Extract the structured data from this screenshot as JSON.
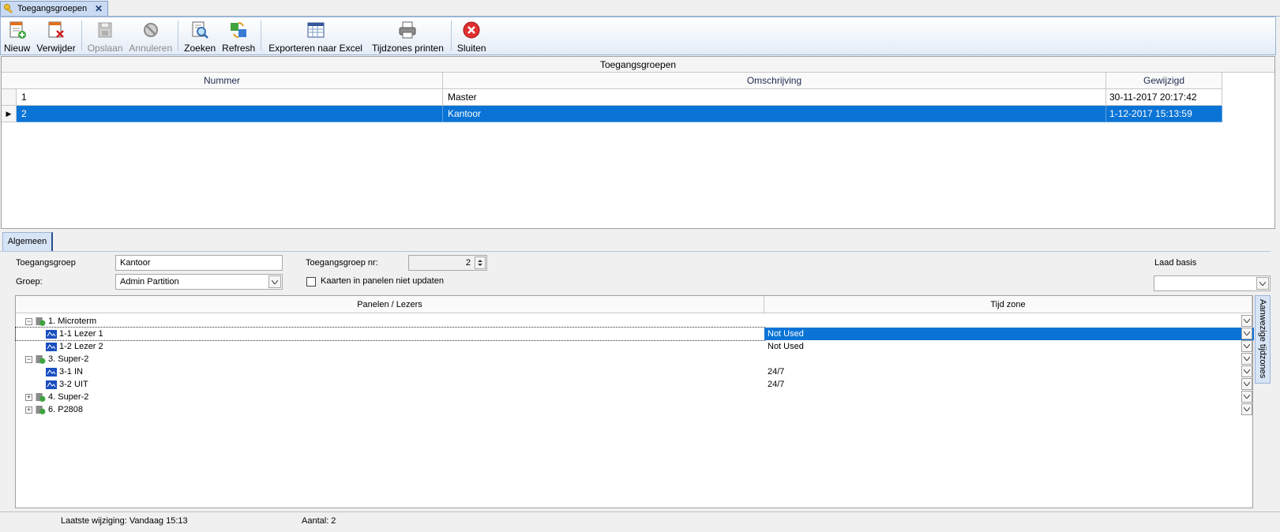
{
  "doc_tab": {
    "title": "Toegangsgroepen",
    "close": "✕"
  },
  "toolbar": {
    "new": "Nieuw",
    "delete": "Verwijder",
    "save": "Opslaan",
    "cancel": "Annuleren",
    "search": "Zoeken",
    "refresh": "Refresh",
    "export": "Exporteren naar Excel",
    "print": "Tijdzones printen",
    "close": "Sluiten"
  },
  "grid": {
    "caption": "Toegangsgroepen",
    "columns": [
      "Nummer",
      "Omschrijving",
      "Gewijzigd"
    ],
    "rows": [
      {
        "nummer": "1",
        "omschrijving": "Master",
        "gewijzigd": "30-11-2017 20:17:42"
      },
      {
        "nummer": "2",
        "omschrijving": "Kantoor",
        "gewijzigd": "1-12-2017 15:13:59"
      }
    ],
    "selected_row_marker": "▶"
  },
  "tab": {
    "algemeen": "Algemeen"
  },
  "form": {
    "toegangsgroep_label": "Toegangsgroep",
    "toegangsgroep_value": "Kantoor",
    "groep_label": "Groep:",
    "groep_value": "Admin Partition",
    "nr_label": "Toegangsgroep nr:",
    "nr_value": "2",
    "checkbox_label": "Kaarten in panelen niet updaten",
    "laad_basis_label": "Laad basis",
    "laad_basis_value": ""
  },
  "tree": {
    "columns": [
      "Panelen / Lezers",
      "Tijd zone"
    ],
    "rows": [
      {
        "name": "1. Microterm",
        "zone": "",
        "expander": "−"
      },
      {
        "name": "1-1 Lezer 1",
        "zone": "Not Used"
      },
      {
        "name": "1-2 Lezer 2",
        "zone": "Not Used"
      },
      {
        "name": "3. Super-2",
        "zone": "",
        "expander": "−"
      },
      {
        "name": "3-1 IN",
        "zone": "24/7"
      },
      {
        "name": "3-2 UIT",
        "zone": "24/7"
      },
      {
        "name": "4. Super-2",
        "zone": "",
        "expander": "+"
      },
      {
        "name": "6. P2808",
        "zone": "",
        "expander": "+"
      }
    ]
  },
  "side_tab": "Aanwezige tijdzones",
  "status": {
    "last_change": "Laatste wijziging: Vandaag 15:13",
    "count": "Aantal: 2"
  },
  "icons": {
    "new": "new-document-icon",
    "delete": "delete-document-icon",
    "save": "save-icon",
    "cancel": "cancel-icon",
    "search": "search-icon",
    "refresh": "refresh-icon",
    "export": "excel-icon",
    "print": "printer-icon",
    "close": "close-circle-icon"
  },
  "colors": {
    "selection": "#0a74d6",
    "toolbar_border": "#9ab4d6",
    "close_red": "#e03030"
  }
}
